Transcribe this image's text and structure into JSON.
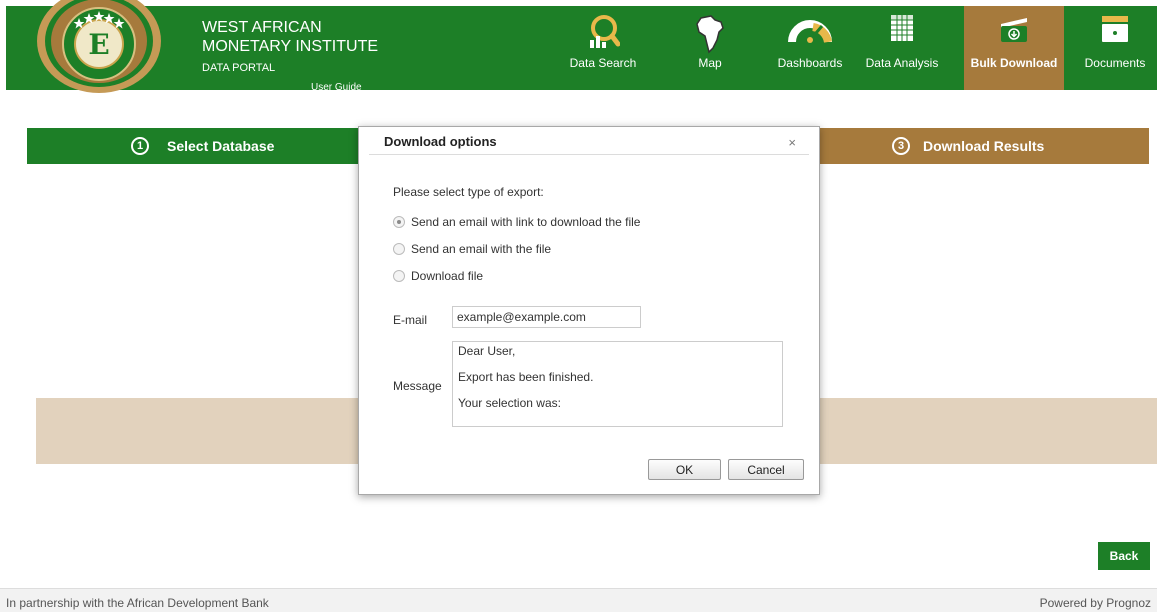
{
  "brand": {
    "line1": "WEST AFRICAN",
    "line2": "MONETARY INSTITUTE",
    "line3": "DATA PORTAL",
    "user_guide": "User Guide"
  },
  "nav": [
    {
      "label": "Data Search",
      "icon": "magnifier-chart-icon",
      "active": false
    },
    {
      "label": "Map",
      "icon": "africa-map-icon",
      "active": false
    },
    {
      "label": "Dashboards",
      "icon": "gauge-icon",
      "active": false
    },
    {
      "label": "Data Analysis",
      "icon": "table-grid-icon",
      "active": false
    },
    {
      "label": "Bulk Download",
      "icon": "folder-download-icon",
      "active": true
    },
    {
      "label": "Documents",
      "icon": "document-tray-icon",
      "active": false
    }
  ],
  "steps": {
    "step1": {
      "num": "1",
      "label": "Select Database"
    },
    "step3": {
      "num": "3",
      "label": "Download Results"
    }
  },
  "dialog": {
    "title": "Download options",
    "close": "×",
    "prompt": "Please select type of export:",
    "options": [
      {
        "label": "Send an email with link to download the file",
        "checked": true
      },
      {
        "label": "Send an email with the file",
        "checked": false
      },
      {
        "label": "Download file",
        "checked": false
      }
    ],
    "email_label": "E-mail",
    "email_value": "example@example.com",
    "message_label": "Message",
    "message_lines": [
      "Dear User,",
      "Export has been finished.",
      "Your selection was:"
    ],
    "ok": "OK",
    "cancel": "Cancel"
  },
  "back": "Back",
  "footer": {
    "left": "In partnership with the African Development Bank",
    "right": "Powered by Prognoz"
  },
  "colors": {
    "green": "#1d7f27",
    "gold": "#a67a3c",
    "tan": "#e2d2bd"
  }
}
